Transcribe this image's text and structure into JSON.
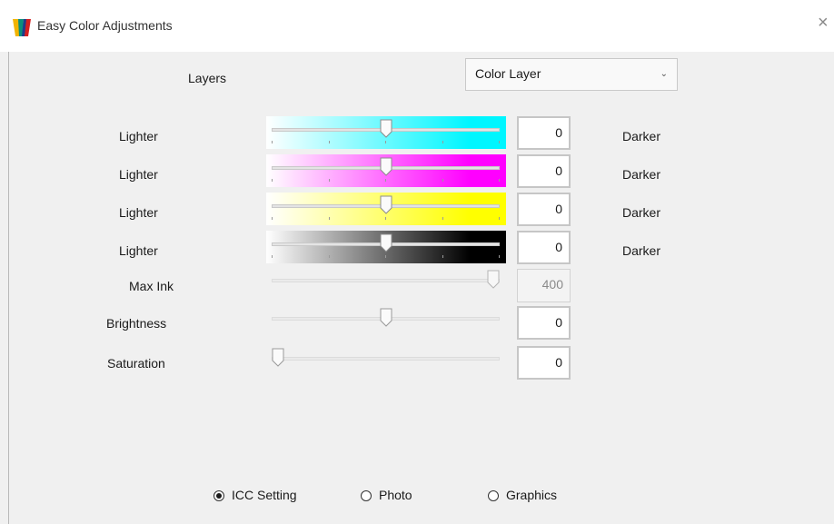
{
  "window": {
    "title": "Easy Color Adjustments",
    "close_glyph": "×"
  },
  "layers": {
    "label": "Layers",
    "selected": "Color Layer"
  },
  "color_rows": [
    {
      "left_label": "Lighter",
      "right_label": "Darker",
      "value": "0",
      "color": "#00f6ff",
      "level": 0.5
    },
    {
      "left_label": "Lighter",
      "right_label": "Darker",
      "value": "0",
      "color": "#ff00ff",
      "level": 0.5
    },
    {
      "left_label": "Lighter",
      "right_label": "Darker",
      "value": "0",
      "color": "#ffff00",
      "level": 0.5
    },
    {
      "left_label": "Lighter",
      "right_label": "Darker",
      "value": "0",
      "color": "#000000",
      "level": 0.5
    }
  ],
  "max_ink": {
    "label": "Max Ink",
    "value": "400",
    "level": 1.0,
    "disabled": true
  },
  "brightness": {
    "label": "Brightness",
    "value": "0",
    "level": 0.5
  },
  "saturation": {
    "label": "Saturation",
    "value": "0",
    "level": 0.0
  },
  "modes": [
    {
      "label": "ICC Setting",
      "checked": true
    },
    {
      "label": "Photo",
      "checked": false
    },
    {
      "label": "Graphics",
      "checked": false
    }
  ],
  "icons": {
    "app": "app-logo-icon",
    "dropdown": "chevron-down-icon",
    "close": "close-icon"
  },
  "colors": {
    "cyan": "#00f6ff",
    "magenta": "#ff00ff",
    "yellow": "#ffff00",
    "black": "#000000",
    "dialog_bg": "#f0f0f0"
  }
}
